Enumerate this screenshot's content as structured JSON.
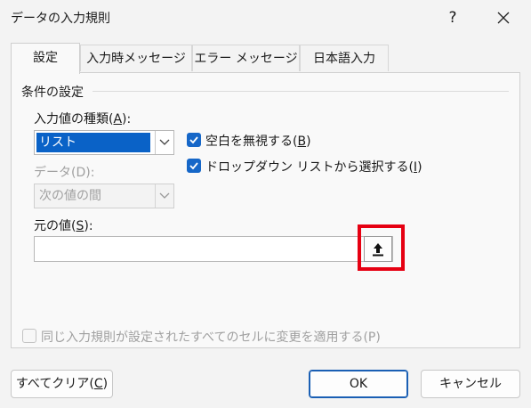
{
  "window": {
    "title": "データの入力規則",
    "help_label": "?"
  },
  "tabs": [
    {
      "label": "設定"
    },
    {
      "label": "入力時メッセージ"
    },
    {
      "label": "エラー メッセージ"
    },
    {
      "label": "日本語入力"
    }
  ],
  "conditions": {
    "group_title": "条件の設定",
    "allow_label": "入力値の種類(",
    "allow_key": "A",
    "allow_label_end": "):",
    "allow_value": "リスト",
    "data_label": "データ(D):",
    "data_value": "次の値の間",
    "ignore_blank_label": "空白を無視する(",
    "ignore_blank_key": "B",
    "ignore_blank_end": ")",
    "ignore_blank_checked": true,
    "dropdown_label": "ドロップダウン リストから選択する(",
    "dropdown_key": "I",
    "dropdown_end": ")",
    "dropdown_checked": true,
    "source_label": "元の値(",
    "source_key": "S",
    "source_label_end": "):",
    "source_value": ""
  },
  "apply_all": {
    "label": "同じ入力規則が設定されたすべてのセルに変更を適用する(P)",
    "checked": false
  },
  "buttons": {
    "clear_all": "すべてクリア(",
    "clear_all_key": "C",
    "clear_all_end": ")",
    "ok": "OK",
    "cancel": "キャンセル"
  },
  "colors": {
    "accent": "#1667c8",
    "highlight": "#e60012"
  }
}
